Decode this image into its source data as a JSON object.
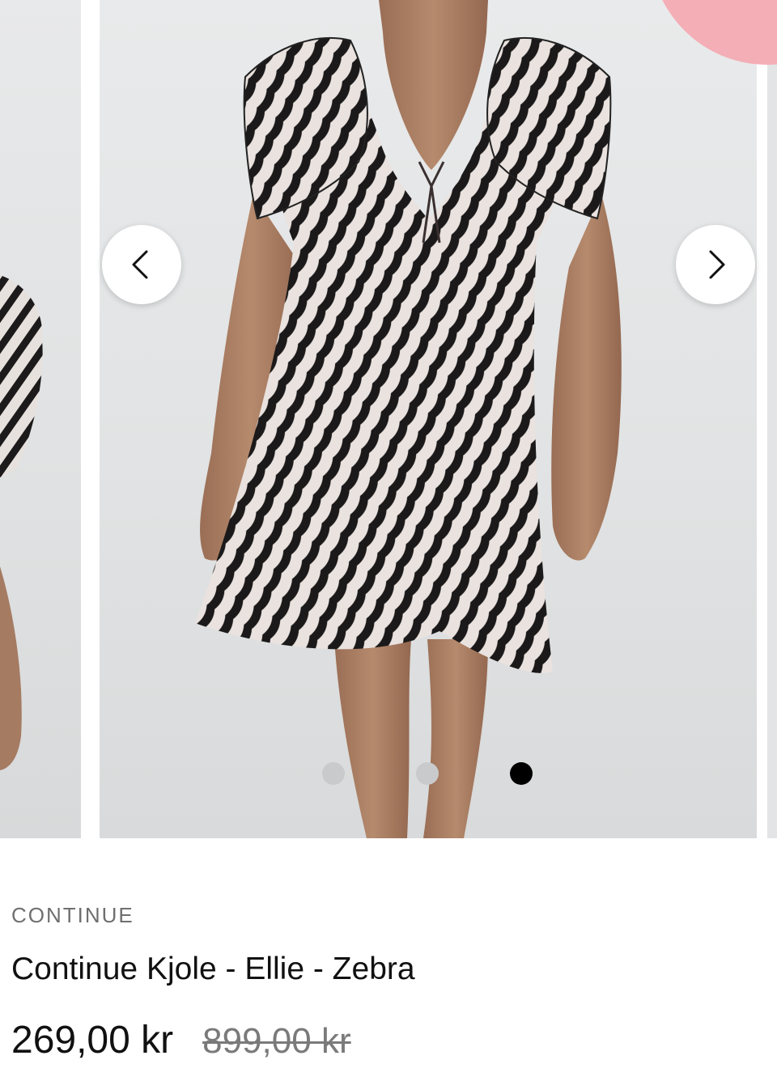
{
  "carousel": {
    "prev_label": "Forrige billede",
    "next_label": "Næste billede",
    "slide_count": 3,
    "active_slide": 3,
    "images": [
      "product-photo-zebra-dress-side",
      "product-photo-zebra-dress-front",
      "product-photo-zebra-dress-next"
    ],
    "icons": {
      "prev": "chevron-left-icon",
      "next": "chevron-right-icon"
    }
  },
  "product": {
    "brand": "CONTINUE",
    "title": "Continue Kjole - Ellie - Zebra",
    "price": "269,00 kr",
    "old_price": "899,00 kr"
  },
  "colors": {
    "sale_badge": "#f4aeb5",
    "dot_active": "#000000",
    "dot_inactive": "#c9cacb",
    "text_primary": "#111111",
    "text_muted": "#6f6f6f"
  }
}
